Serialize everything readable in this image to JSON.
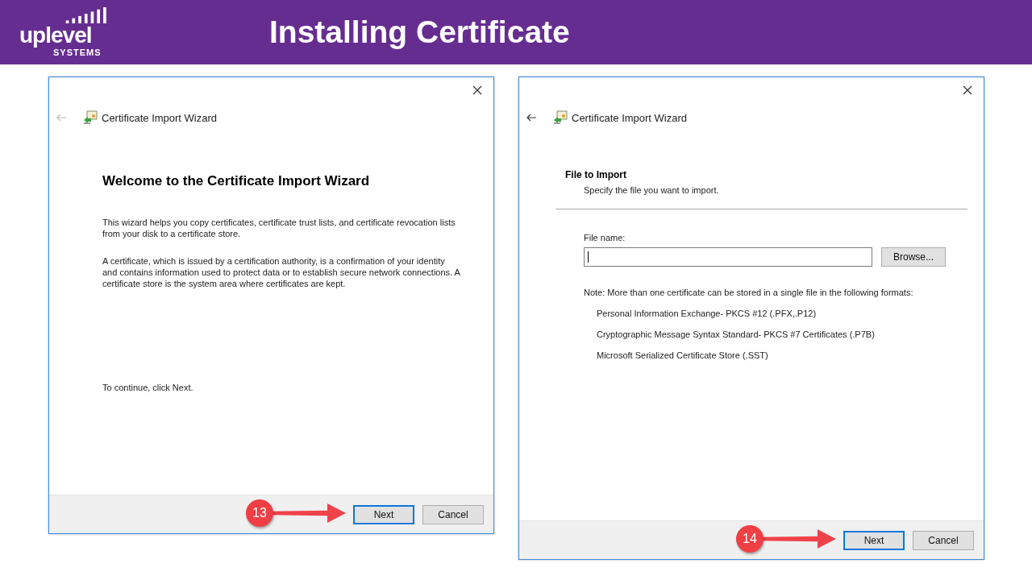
{
  "header": {
    "logo": {
      "wordmark": "uplevel",
      "tagline": "SYSTEMS"
    },
    "title": "Installing Certificate"
  },
  "dialogs": [
    {
      "kind": "welcome",
      "title": "Certificate Import Wizard",
      "back_enabled": false,
      "heading": "Welcome to the Certificate Import Wizard",
      "paragraphs": [
        "This wizard helps you copy certificates, certificate trust lists, and certificate revocation lists from your disk to a certificate store.",
        "A certificate, which is issued by a certification authority, is a confirmation of your identity and contains information used to protect data or to establish secure network connections. A certificate store is the system area where certificates are kept."
      ],
      "footer_text": "To continue, click Next.",
      "buttons": [
        {
          "label": "Next",
          "default": true
        },
        {
          "label": "Cancel",
          "default": false
        }
      ],
      "step": "13"
    },
    {
      "kind": "file_select",
      "title": "Certificate Import Wizard",
      "back_enabled": true,
      "section_title": "File to Import",
      "section_subtitle": "Specify the file you want to import.",
      "field_label": "File name:",
      "browse_label": "Browse...",
      "note": "Note:  More than one certificate can be stored in a single file in the following formats:",
      "formats": [
        "Personal Information Exchange- PKCS #12 (.PFX,.P12)",
        "Cryptographic Message Syntax Standard- PKCS #7 Certificates (.P7B)",
        "Microsoft Serialized Certificate Store (.SST)"
      ],
      "buttons": [
        {
          "label": "Next",
          "default": true
        },
        {
          "label": "Cancel",
          "default": false
        }
      ],
      "step": "14"
    }
  ]
}
